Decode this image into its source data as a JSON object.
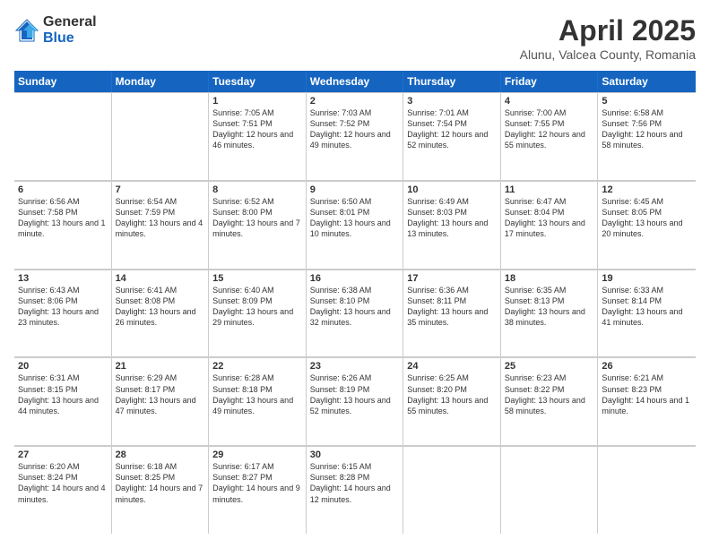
{
  "logo": {
    "general": "General",
    "blue": "Blue"
  },
  "header": {
    "title": "April 2025",
    "subtitle": "Alunu, Valcea County, Romania"
  },
  "days_of_week": [
    "Sunday",
    "Monday",
    "Tuesday",
    "Wednesday",
    "Thursday",
    "Friday",
    "Saturday"
  ],
  "weeks": [
    [
      {
        "day": "",
        "info": ""
      },
      {
        "day": "",
        "info": ""
      },
      {
        "day": "1",
        "info": "Sunrise: 7:05 AM\nSunset: 7:51 PM\nDaylight: 12 hours and 46 minutes."
      },
      {
        "day": "2",
        "info": "Sunrise: 7:03 AM\nSunset: 7:52 PM\nDaylight: 12 hours and 49 minutes."
      },
      {
        "day": "3",
        "info": "Sunrise: 7:01 AM\nSunset: 7:54 PM\nDaylight: 12 hours and 52 minutes."
      },
      {
        "day": "4",
        "info": "Sunrise: 7:00 AM\nSunset: 7:55 PM\nDaylight: 12 hours and 55 minutes."
      },
      {
        "day": "5",
        "info": "Sunrise: 6:58 AM\nSunset: 7:56 PM\nDaylight: 12 hours and 58 minutes."
      }
    ],
    [
      {
        "day": "6",
        "info": "Sunrise: 6:56 AM\nSunset: 7:58 PM\nDaylight: 13 hours and 1 minute."
      },
      {
        "day": "7",
        "info": "Sunrise: 6:54 AM\nSunset: 7:59 PM\nDaylight: 13 hours and 4 minutes."
      },
      {
        "day": "8",
        "info": "Sunrise: 6:52 AM\nSunset: 8:00 PM\nDaylight: 13 hours and 7 minutes."
      },
      {
        "day": "9",
        "info": "Sunrise: 6:50 AM\nSunset: 8:01 PM\nDaylight: 13 hours and 10 minutes."
      },
      {
        "day": "10",
        "info": "Sunrise: 6:49 AM\nSunset: 8:03 PM\nDaylight: 13 hours and 13 minutes."
      },
      {
        "day": "11",
        "info": "Sunrise: 6:47 AM\nSunset: 8:04 PM\nDaylight: 13 hours and 17 minutes."
      },
      {
        "day": "12",
        "info": "Sunrise: 6:45 AM\nSunset: 8:05 PM\nDaylight: 13 hours and 20 minutes."
      }
    ],
    [
      {
        "day": "13",
        "info": "Sunrise: 6:43 AM\nSunset: 8:06 PM\nDaylight: 13 hours and 23 minutes."
      },
      {
        "day": "14",
        "info": "Sunrise: 6:41 AM\nSunset: 8:08 PM\nDaylight: 13 hours and 26 minutes."
      },
      {
        "day": "15",
        "info": "Sunrise: 6:40 AM\nSunset: 8:09 PM\nDaylight: 13 hours and 29 minutes."
      },
      {
        "day": "16",
        "info": "Sunrise: 6:38 AM\nSunset: 8:10 PM\nDaylight: 13 hours and 32 minutes."
      },
      {
        "day": "17",
        "info": "Sunrise: 6:36 AM\nSunset: 8:11 PM\nDaylight: 13 hours and 35 minutes."
      },
      {
        "day": "18",
        "info": "Sunrise: 6:35 AM\nSunset: 8:13 PM\nDaylight: 13 hours and 38 minutes."
      },
      {
        "day": "19",
        "info": "Sunrise: 6:33 AM\nSunset: 8:14 PM\nDaylight: 13 hours and 41 minutes."
      }
    ],
    [
      {
        "day": "20",
        "info": "Sunrise: 6:31 AM\nSunset: 8:15 PM\nDaylight: 13 hours and 44 minutes."
      },
      {
        "day": "21",
        "info": "Sunrise: 6:29 AM\nSunset: 8:17 PM\nDaylight: 13 hours and 47 minutes."
      },
      {
        "day": "22",
        "info": "Sunrise: 6:28 AM\nSunset: 8:18 PM\nDaylight: 13 hours and 49 minutes."
      },
      {
        "day": "23",
        "info": "Sunrise: 6:26 AM\nSunset: 8:19 PM\nDaylight: 13 hours and 52 minutes."
      },
      {
        "day": "24",
        "info": "Sunrise: 6:25 AM\nSunset: 8:20 PM\nDaylight: 13 hours and 55 minutes."
      },
      {
        "day": "25",
        "info": "Sunrise: 6:23 AM\nSunset: 8:22 PM\nDaylight: 13 hours and 58 minutes."
      },
      {
        "day": "26",
        "info": "Sunrise: 6:21 AM\nSunset: 8:23 PM\nDaylight: 14 hours and 1 minute."
      }
    ],
    [
      {
        "day": "27",
        "info": "Sunrise: 6:20 AM\nSunset: 8:24 PM\nDaylight: 14 hours and 4 minutes."
      },
      {
        "day": "28",
        "info": "Sunrise: 6:18 AM\nSunset: 8:25 PM\nDaylight: 14 hours and 7 minutes."
      },
      {
        "day": "29",
        "info": "Sunrise: 6:17 AM\nSunset: 8:27 PM\nDaylight: 14 hours and 9 minutes."
      },
      {
        "day": "30",
        "info": "Sunrise: 6:15 AM\nSunset: 8:28 PM\nDaylight: 14 hours and 12 minutes."
      },
      {
        "day": "",
        "info": ""
      },
      {
        "day": "",
        "info": ""
      },
      {
        "day": "",
        "info": ""
      }
    ]
  ]
}
